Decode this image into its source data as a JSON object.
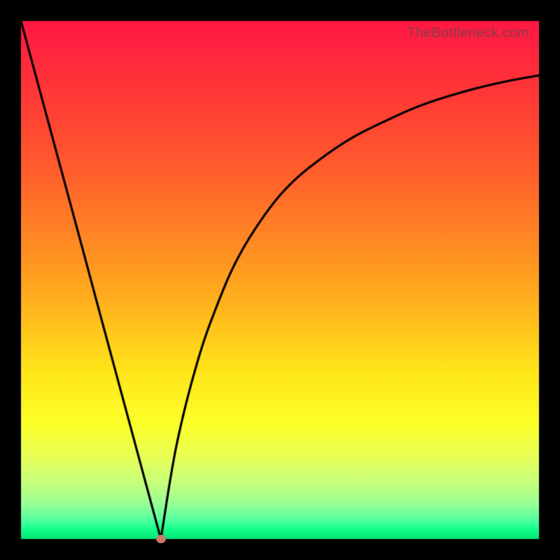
{
  "watermark": "TheBottleneck.com",
  "colors": {
    "frame": "#000000",
    "curve": "#000000",
    "dot": "#c97b6d",
    "gradient_top": "#ff1744",
    "gradient_bottom": "#00e676"
  },
  "chart_data": {
    "type": "line",
    "title": "",
    "xlabel": "",
    "ylabel": "",
    "xlim": [
      0,
      1
    ],
    "ylim": [
      0,
      1
    ],
    "series": [
      {
        "name": "left-branch",
        "x": [
          0.0,
          0.03,
          0.06,
          0.09,
          0.12,
          0.15,
          0.18,
          0.21,
          0.24,
          0.27
        ],
        "y": [
          1.0,
          0.889,
          0.778,
          0.667,
          0.556,
          0.444,
          0.333,
          0.222,
          0.111,
          0.0
        ]
      },
      {
        "name": "right-branch",
        "x": [
          0.27,
          0.3,
          0.34,
          0.38,
          0.42,
          0.47,
          0.52,
          0.58,
          0.64,
          0.71,
          0.78,
          0.86,
          0.93,
          1.0
        ],
        "y": [
          0.0,
          0.18,
          0.34,
          0.455,
          0.545,
          0.625,
          0.685,
          0.735,
          0.775,
          0.81,
          0.84,
          0.865,
          0.882,
          0.895
        ]
      }
    ],
    "marker": {
      "x": 0.27,
      "y": 0.0
    },
    "notes": "x is normalized horizontal position (0=left edge of plot, 1=right edge). y is normalized height (0=bottom=green=optimal, 1=top=red=worst). Values estimated from pixels; no axis ticks or labels are present in the source image."
  }
}
